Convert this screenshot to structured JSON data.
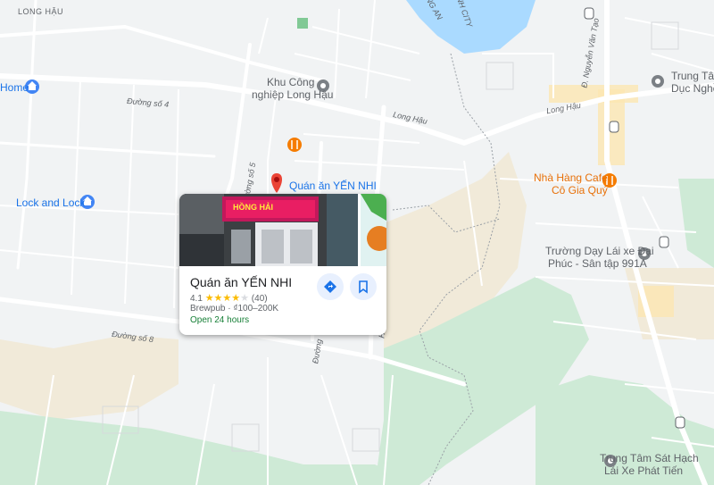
{
  "labels": {
    "long_hau_top": "LONG HẬU",
    "ng_an": "NG AN",
    "nh_city": "NH CITY",
    "khu_cong_1": "Khu Công",
    "khu_cong_2": "nghiệp Long Hậu",
    "home": "Home",
    "duong_so_4": "Đường số 4",
    "long_hau_road_1": "Long Hậu",
    "long_hau_road_2": "Long Hậu",
    "lock_and_lock": "Lock and Lock",
    "duong_so_5": "Đường số 5",
    "duong_so_8": "Đường số 8",
    "duong_v": "Đường",
    "nguyen_van_tao": "Đ. Nguyễn Văn Tạo",
    "trung_tam_sat_1": "Trung Tâm Sát",
    "trung_tam_sat_2": "Dục Nghề N",
    "nha_hang_1": "Nhà Hàng Cafe",
    "nha_hang_2": "Cô Gia Quý",
    "truong_day_1": "Trường Dạy Lái xe Đại",
    "truong_day_2": "Phúc - Sân tập 991A",
    "trung_tam_sh_1": "Trung Tâm Sát Hạch",
    "trung_tam_sh_2": "Lái Xe Phát Tiến",
    "pin_label": "Quán ăn YẾN NHI",
    "side_tag": "H"
  },
  "card": {
    "title": "Quán ăn YẾN NHI",
    "rating": "4.1",
    "rating_value": 4.1,
    "stars_full": "★★★★",
    "stars_empty": "★",
    "reviews": "(40)",
    "category": "Brewpub · ₫100–200K",
    "hours": "Open 24 hours",
    "sign_text": "HỒNG HẢI",
    "directions_icon": "directions-icon",
    "save_icon": "bookmark-icon"
  },
  "colors": {
    "background": "#f1f3f4",
    "road": "#ffffff",
    "water": "#aadaff",
    "green": "#ceead6",
    "sand": "#f1ead9",
    "highlight": "#fde6b1",
    "accent": "#1a73e8",
    "pin": "#ea4335",
    "poi_orange": "#f57c00",
    "open_green": "#188038"
  }
}
